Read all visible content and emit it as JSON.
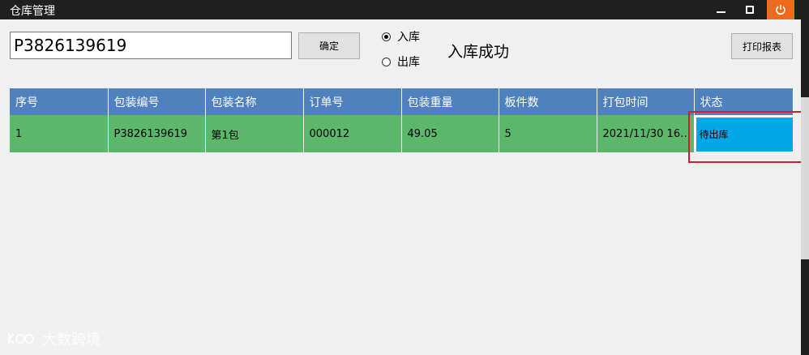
{
  "window": {
    "title": "仓库管理"
  },
  "titlebar_buttons": {
    "minimize": "minimize-icon",
    "maximize": "maximize-icon",
    "close": "power-icon"
  },
  "form": {
    "barcode_value": "P3826139619",
    "confirm_label": "确定",
    "radio_in_label": "入库",
    "radio_out_label": "出库",
    "radio_selected": "入库",
    "status_message": "入库成功",
    "print_label": "打印报表"
  },
  "grid": {
    "columns": [
      "序号",
      "包装编号",
      "包装名称",
      "订单号",
      "包装重量",
      "板件数",
      "打包时间",
      "状态"
    ],
    "rows": [
      {
        "cells": [
          "1",
          "P3826139619",
          "第1包",
          "000012",
          "49.05",
          "5",
          "2021/11/30 16:...",
          "待出库"
        ]
      }
    ]
  },
  "colors": {
    "header_bg": "#4f81bd",
    "row_bg": "#5bb86a",
    "state_bg": "#00a8e8",
    "highlight": "#d0202a",
    "close_bg": "#f06a1d"
  },
  "watermark": {
    "text": "大数跨境",
    "icon": "logo-icon"
  }
}
